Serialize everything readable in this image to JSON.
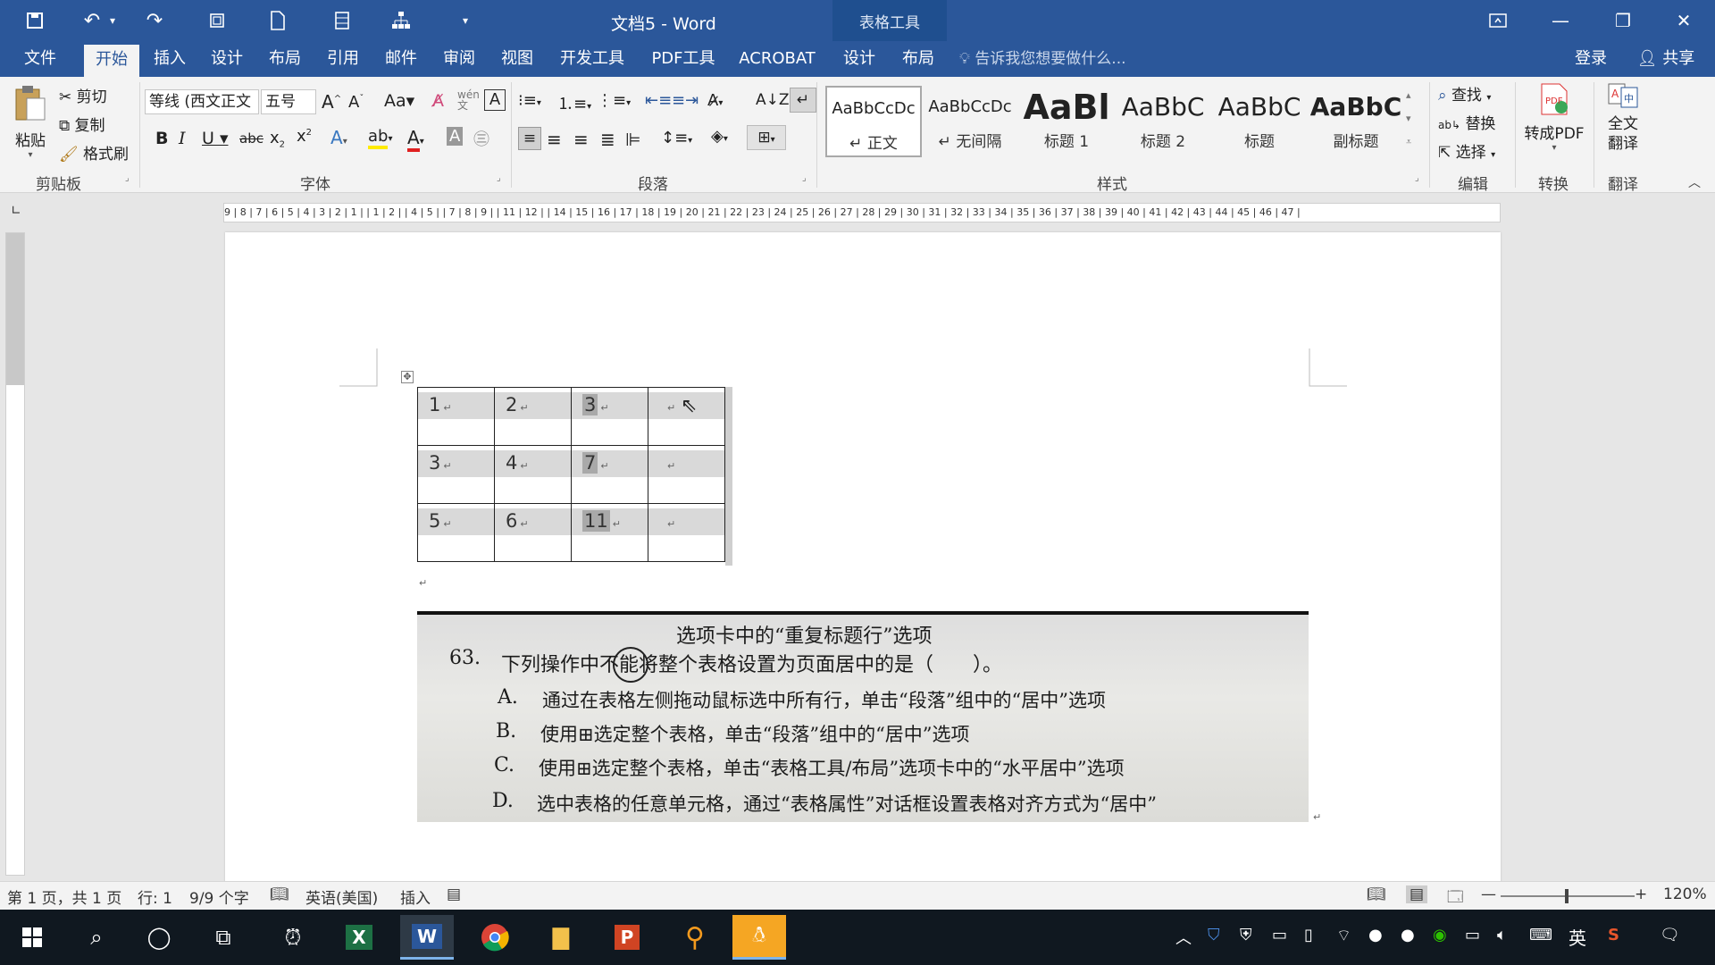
{
  "titlebar": {
    "title": "文档5 - Word",
    "context_tab": "表格工具"
  },
  "tabs": [
    "文件",
    "开始",
    "插入",
    "设计",
    "布局",
    "引用",
    "邮件",
    "审阅",
    "视图",
    "开发工具",
    "PDF工具",
    "ACROBAT",
    "设计",
    "布局"
  ],
  "tellme": "告诉我您想要做什么...",
  "account": {
    "signin": "登录",
    "share": "共享"
  },
  "ribbon": {
    "clipboard": {
      "paste": "粘贴",
      "cut": "剪切",
      "copy": "复制",
      "format_painter": "格式刷",
      "label": "剪贴板"
    },
    "font": {
      "font_name": "等线 (西文正文",
      "font_size": "五号",
      "label": "字体"
    },
    "paragraph": {
      "label": "段落"
    },
    "styles": {
      "label": "样式",
      "items": [
        {
          "preview": "AaBbCcDc",
          "name": "↵ 正文"
        },
        {
          "preview": "AaBbCcDc",
          "name": "↵ 无间隔"
        },
        {
          "preview": "AaBl",
          "name": "标题 1"
        },
        {
          "preview": "AaBbC",
          "name": "标题 2"
        },
        {
          "preview": "AaBbC",
          "name": "标题"
        },
        {
          "preview": "AaBbC",
          "name": "副标题"
        }
      ]
    },
    "editing": {
      "find": "查找",
      "replace": "替换",
      "select": "选择",
      "label": "编辑"
    },
    "convert": {
      "to_pdf": "转成PDF",
      "label": "转换"
    },
    "translate": {
      "full": "全文",
      "translate": "翻译",
      "label": "翻译"
    }
  },
  "ruler_text": "9 | 8 | 7 | 6 | 5 | 4 | 3 | 2 | 1 |   | 1 | 2 |   | 4 | 5 |   | 7 | 8 | 9 |   | 11 | 12 |   | 14 | 15 | 16 | 17 | 18 | 19 | 20 | 21 | 22 | 23 | 24 | 25 | 26 | 27 | 28 | 29 | 30 | 31 | 32 | 33 | 34 | 35 | 36 | 37 | 38 | 39 | 40 | 41 | 42 | 43 | 44 | 45 | 46 | 47 |",
  "table": {
    "rows": [
      [
        "1",
        "2",
        "3",
        ""
      ],
      [
        "3",
        "4",
        "7",
        ""
      ],
      [
        "5",
        "6",
        "11",
        ""
      ]
    ]
  },
  "photo": {
    "line0": "选项卡中的“重复标题行”选项",
    "q_num": "63.",
    "question": "下列操作中不能将整个表格设置为页面居中的是（　　）。",
    "options": [
      {
        "key": "A.",
        "text": "通过在表格左侧拖动鼠标选中所有行，单击“段落”组中的“居中”选项"
      },
      {
        "key": "B.",
        "text": "使用⊞选定整个表格，单击“段落”组中的“居中”选项"
      },
      {
        "key": "C.",
        "text": "使用⊞选定整个表格，单击“表格工具/布局”选项卡中的“水平居中”选项"
      },
      {
        "key": "D.",
        "text": "选中表格的任意单元格，通过“表格属性”对话框设置表格对齐方式为“居中”"
      }
    ]
  },
  "statusbar": {
    "page": "第 1 页，共 1 页",
    "line": "行: 1",
    "words": "9/9 个字",
    "language": "英语(美国)",
    "mode": "插入",
    "zoom": "120%"
  },
  "taskbar": {
    "ime": "英"
  },
  "colors": {
    "accent": "#2b579a",
    "taskbar": "#101820"
  }
}
